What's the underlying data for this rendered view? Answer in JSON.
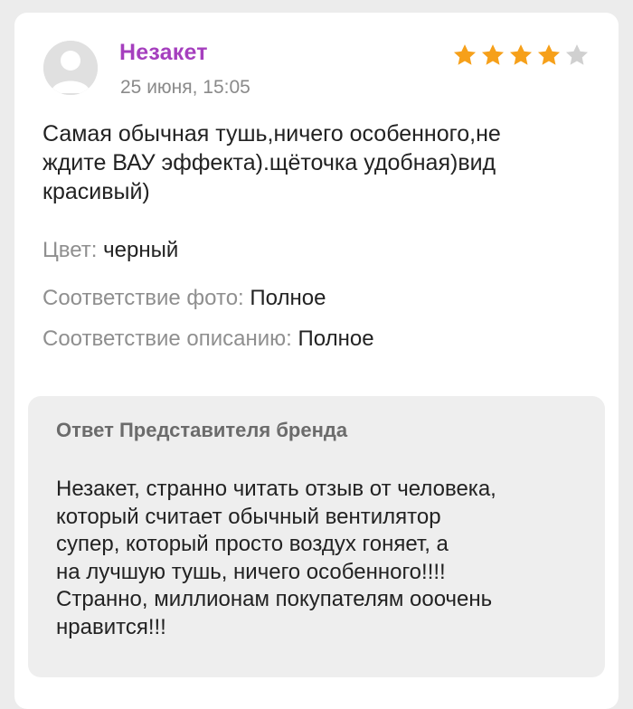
{
  "review": {
    "author": "Незакет",
    "date": "25 июня, 15:05",
    "rating": 4,
    "rating_max": 5,
    "star_color": "#f6a01a",
    "star_empty_color": "#d0d0d0",
    "text_lines": [
      "Самая обычная тушь,ничего особенного,не",
      "ждите ВАУ эффекта).щёточка удобная)вид",
      "красивый)"
    ],
    "attributes": [
      {
        "key": "Цвет:",
        "value": "черный"
      },
      {
        "key": "Соответствие фото:",
        "value": "Полное"
      },
      {
        "key": "Соответствие описанию:",
        "value": "Полное"
      }
    ]
  },
  "reply": {
    "title": "Ответ Представителя бренда",
    "text_lines": [
      "Незакет, странно читать отзыв от человека,",
      "который считает обычный вентилятор",
      "супер, который просто воздух гоняет, а",
      "на лучшую тушь, ничего особенного!!!!",
      "Странно, миллионам покупателям ооочень",
      "нравится!!!"
    ]
  },
  "colors": {
    "author": "#a53fbe",
    "reply_background": "#eeeeee",
    "page_background": "#ececec"
  }
}
